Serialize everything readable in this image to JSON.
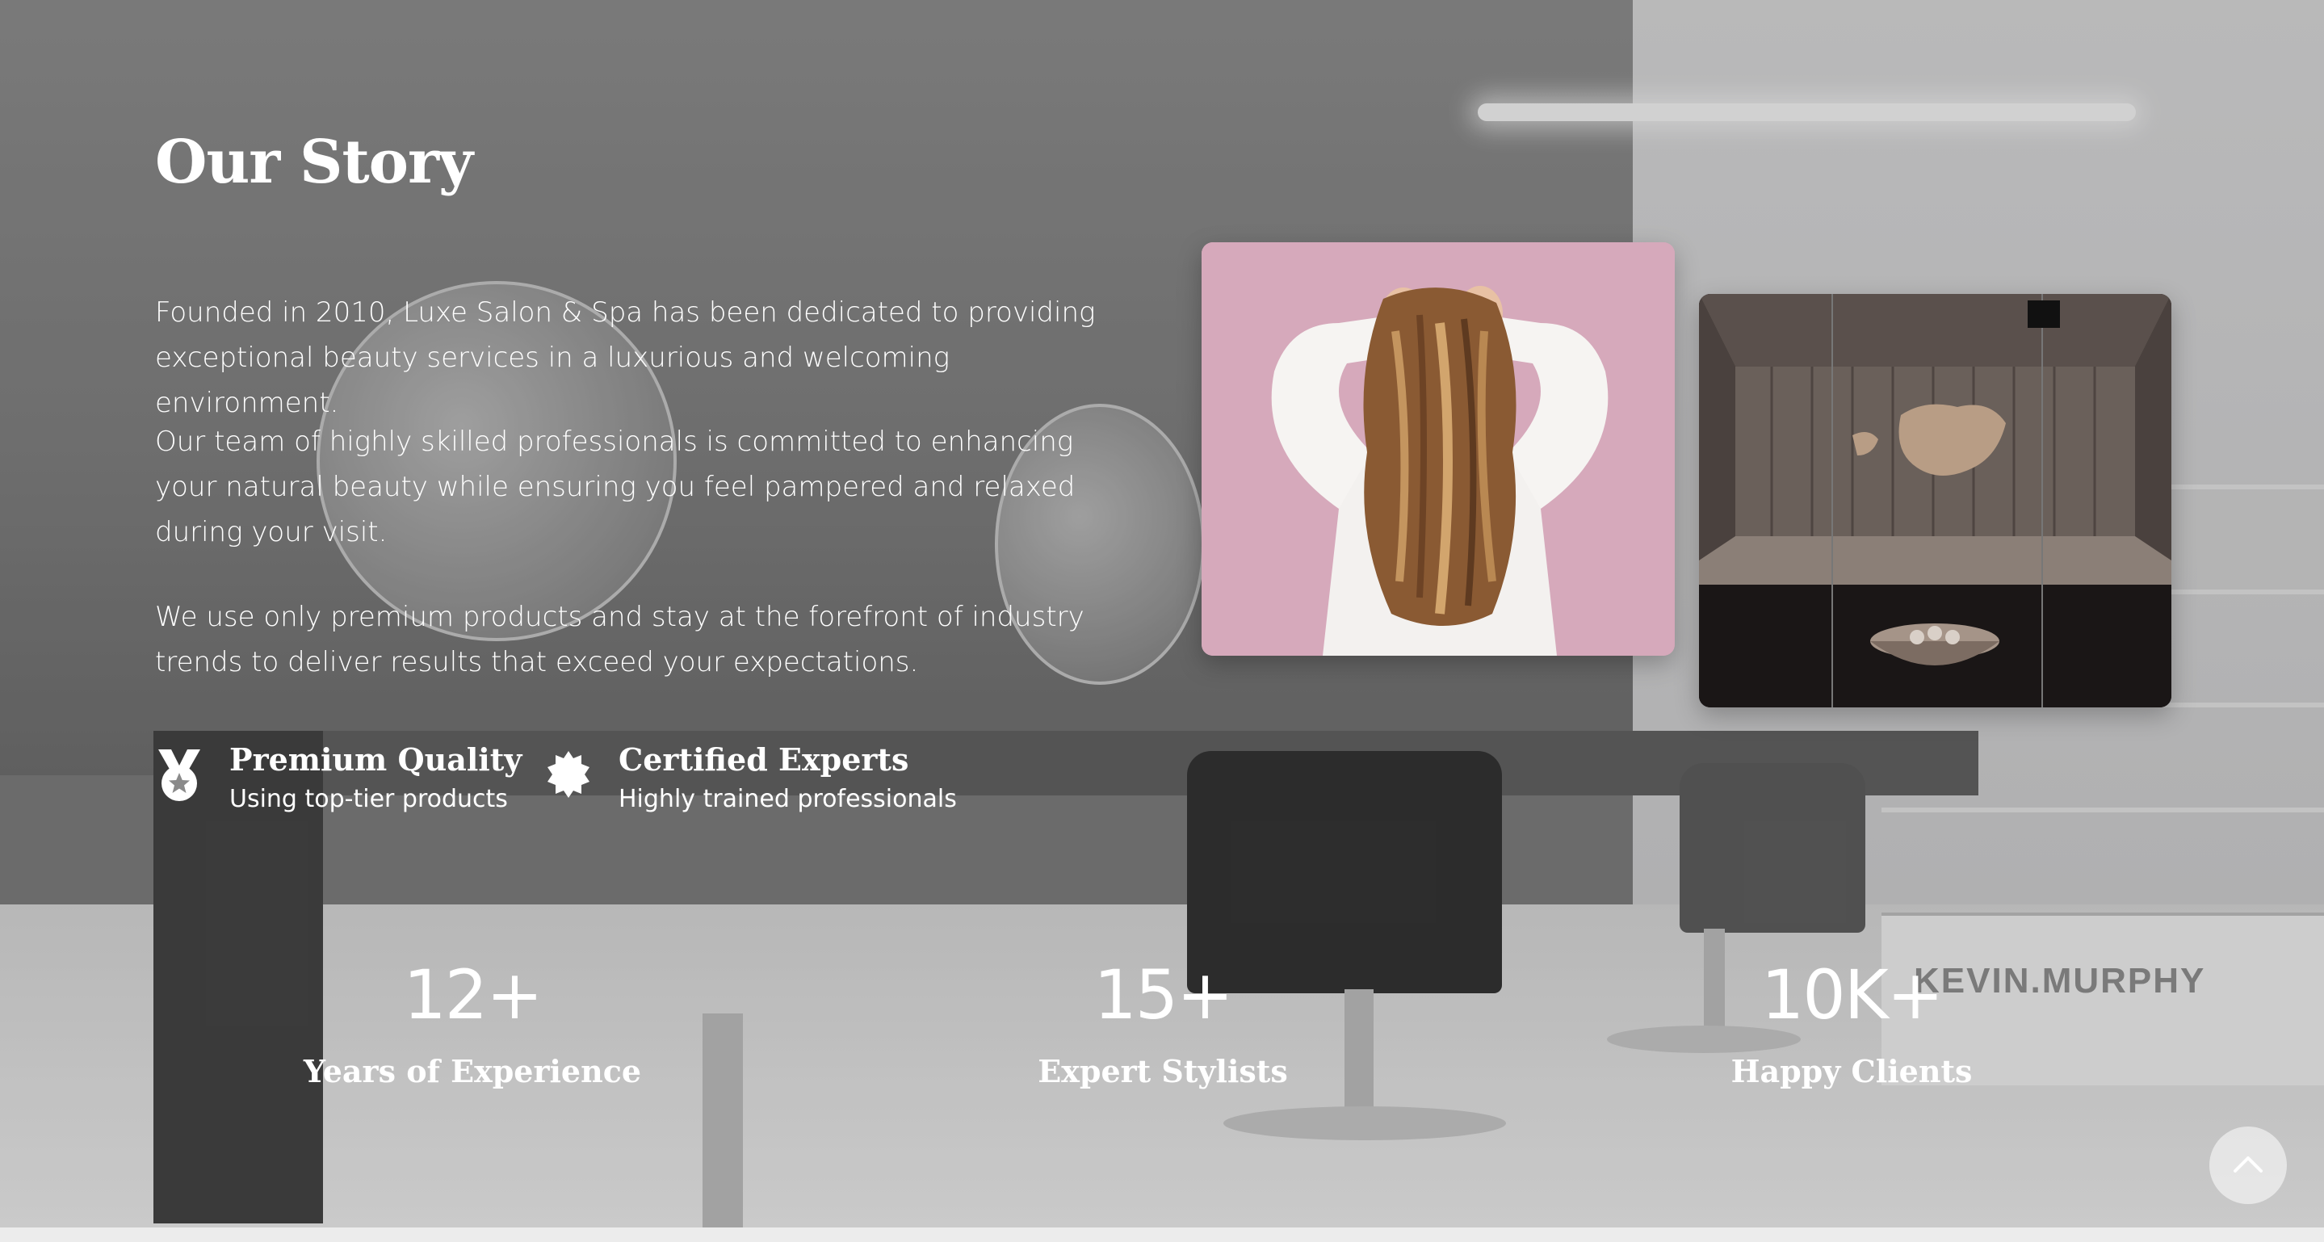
{
  "story": {
    "title": "Our Story",
    "paragraphs": [
      "Founded in 2010, Luxe Salon & Spa has been dedicated to providing exceptional beauty services in a luxurious and welcoming environment.",
      "Our team of highly skilled professionals is committed to enhancing your natural beauty while ensuring you feel pampered and relaxed during your visit.",
      "We use only premium products and stay at the forefront of industry trends to deliver results that exceed your expectations."
    ]
  },
  "features": [
    {
      "icon": "medal-icon",
      "title": "Premium Quality",
      "subtitle": "Using top-tier products"
    },
    {
      "icon": "certificate-badge-icon",
      "title": "Certified Experts",
      "subtitle": "Highly trained professionals"
    }
  ],
  "background": {
    "signage": "KEVIN.MURPHY"
  },
  "stats": [
    {
      "value": "12+",
      "label": "Years of Experience"
    },
    {
      "value": "15+",
      "label": "Expert Stylists"
    },
    {
      "value": "10K+",
      "label": "Happy Clients"
    }
  ],
  "images": [
    {
      "name": "woman-long-wavy-hair-photo"
    },
    {
      "name": "sauna-room-photo"
    }
  ],
  "controls": {
    "scroll_top_icon": "chevron-up-icon"
  },
  "colors": {
    "text": "#ffffff",
    "hair_photo_bg": "#d9aebf",
    "sauna_wood": "#4a4240"
  }
}
